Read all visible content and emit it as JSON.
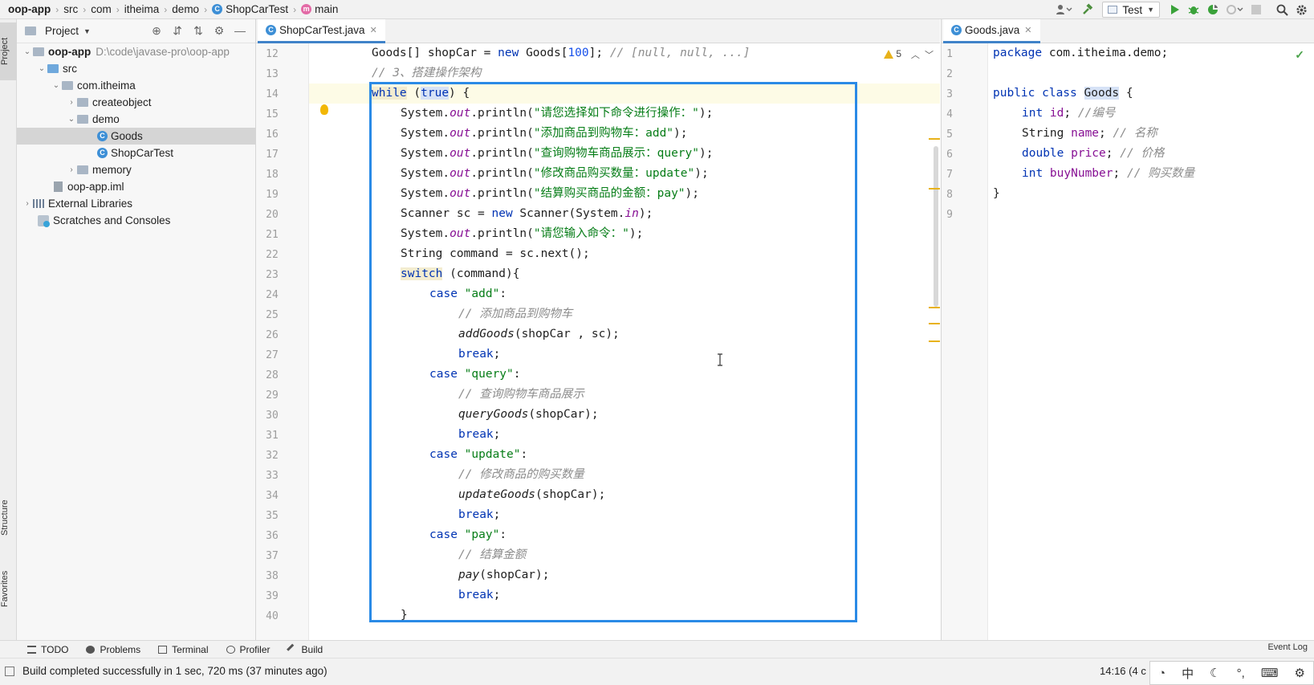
{
  "breadcrumb": {
    "items": [
      "oop-app",
      "src",
      "com",
      "itheima",
      "demo",
      "ShopCarTest",
      "main"
    ]
  },
  "toolbar": {
    "run_config": "Test"
  },
  "side_tabs": {
    "project": "Project",
    "structure": "Structure",
    "favorites": "Favorites"
  },
  "project_panel": {
    "title": "Project",
    "root_name": "oop-app",
    "root_path": "D:\\code\\javase-pro\\oop-app",
    "nodes": {
      "src": "src",
      "pkg": "com.itheima",
      "createobject": "createobject",
      "demo": "demo",
      "goods": "Goods",
      "shopcartest": "ShopCarTest",
      "memory": "memory",
      "iml": "oop-app.iml",
      "libs": "External Libraries",
      "scratches": "Scratches and Consoles"
    }
  },
  "editor_left": {
    "tab_label": "ShopCarTest.java",
    "warning_count": "5",
    "line_numbers": [
      "12",
      "13",
      "14",
      "15",
      "16",
      "17",
      "18",
      "19",
      "20",
      "21",
      "22",
      "23",
      "24",
      "25",
      "26",
      "27",
      "28",
      "29",
      "30",
      "31",
      "32",
      "33",
      "34",
      "35",
      "36",
      "37",
      "38",
      "39",
      "40"
    ],
    "lines": {
      "l12a": "Goods[] shopCar = ",
      "l12b": "new",
      "l12c": " Goods[",
      "l12d": "100",
      "l12e": "]; ",
      "l12f": "// [null, null, ...]",
      "l13": "// 3、搭建操作架构",
      "l14a": "while",
      "l14b": " (",
      "l14c": "true",
      "l14d": ") {",
      "l15a": "System.",
      "l15b": "out",
      "l15c": ".println(",
      "l15d": "\"请您选择如下命令进行操作：\"",
      "l15e": ");",
      "l16d": "\"添加商品到购物车：add\"",
      "l17d": "\"查询购物车商品展示：query\"",
      "l18d": "\"修改商品购买数量：update\"",
      "l19d": "\"结算购买商品的金额：pay\"",
      "l20a": "Scanner sc = ",
      "l20b": "new",
      "l20c": " Scanner(System.",
      "l20d": "in",
      "l20e": ");",
      "l21d": "\"请您输入命令：\"",
      "l22": "String command = sc.next();",
      "l23a": "switch",
      "l23b": " (command){",
      "l24a": "case",
      "l24b": "\"add\"",
      "l24c": ":",
      "l25": "// 添加商品到购物车",
      "l26a": "addGoods",
      "l26b": "(shopCar , sc);",
      "l27a": "break",
      "l27b": ";",
      "l28b": "\"query\"",
      "l29": "// 查询购物车商品展示",
      "l30a": "queryGoods",
      "l30b": "(shopCar);",
      "l32b": "\"update\"",
      "l33": "// 修改商品的购买数量",
      "l34a": "updateGoods",
      "l34b": "(shopCar);",
      "l36b": "\"pay\"",
      "l37": "// 结算金额",
      "l38a": "pay",
      "l38b": "(shopCar);",
      "l40": "}"
    }
  },
  "editor_right": {
    "tab_label": "Goods.java",
    "line_numbers": [
      "1",
      "2",
      "3",
      "4",
      "5",
      "6",
      "7",
      "8",
      "9"
    ],
    "lines": {
      "r1a": "package",
      "r1b": " com.itheima.demo;",
      "r3a": "public class",
      "r3b": " ",
      "r3c": "Goods",
      "r3d": " {",
      "r4a": "int",
      "r4b": " id",
      "r4c": "; ",
      "r4d": "//编号",
      "r5a": "String ",
      "r5b": "name",
      "r5c": "; ",
      "r5d": "// 名称",
      "r6a": "double",
      "r6b": " price",
      "r6c": "; ",
      "r6d": "// 价格",
      "r7a": "int",
      "r7b": " buyNumber",
      "r7c": "; ",
      "r7d": "// 购买数量",
      "r8": "}"
    }
  },
  "bottom_tools": {
    "todo": "TODO",
    "problems": "Problems",
    "terminal": "Terminal",
    "profiler": "Profiler",
    "build": "Build",
    "event_log": "Event Log"
  },
  "status": {
    "message": "Build completed successfully in 1 sec, 720 ms (37 minutes ago)",
    "position": "14:16 (4 c"
  },
  "ime": {
    "mode": "中"
  },
  "colors": {
    "accent": "#2a8ae6",
    "keyword": "#0033b3",
    "string": "#067d17",
    "comment": "#8c8c8c",
    "field": "#871094",
    "warning": "#e8b21a"
  }
}
